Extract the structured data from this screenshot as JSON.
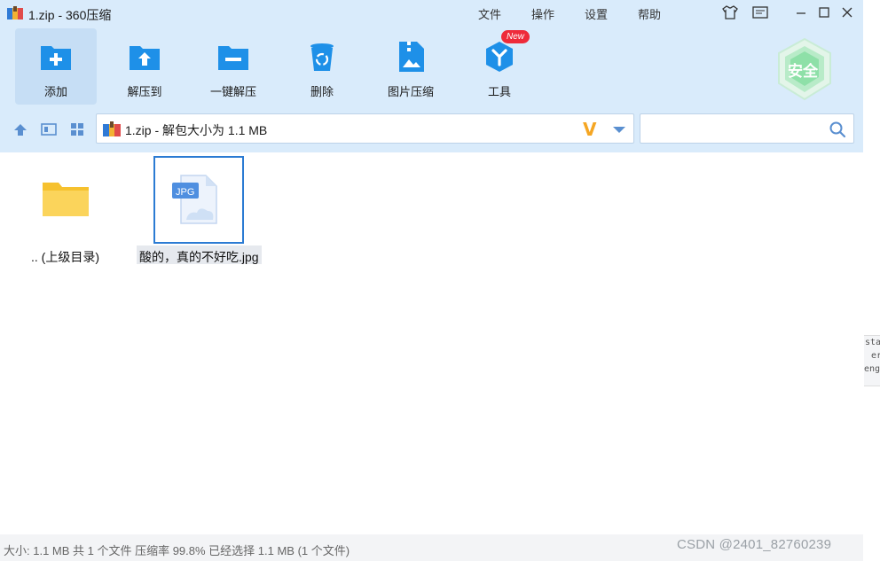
{
  "window": {
    "title": "1.zip - 360压缩",
    "menu": [
      "文件",
      "操作",
      "设置",
      "帮助"
    ]
  },
  "toolbar": {
    "tools": [
      {
        "label": "添加",
        "icon": "add-icon"
      },
      {
        "label": "解压到",
        "icon": "extract-to-icon"
      },
      {
        "label": "一键解压",
        "icon": "one-click-extract-icon"
      },
      {
        "label": "删除",
        "icon": "delete-icon"
      },
      {
        "label": "图片压缩",
        "icon": "image-compress-icon"
      },
      {
        "label": "工具",
        "icon": "tools-icon"
      }
    ],
    "new_badge": "New",
    "safe_badge": "安全"
  },
  "address": {
    "path": "1.zip - 解包大小为 1.1 MB",
    "search_placeholder": ""
  },
  "files": [
    {
      "name": ".. (上级目录)",
      "type": "folder"
    },
    {
      "name": "酸的，真的不好吃.jpg",
      "type": "jpg",
      "badge": "JPG",
      "selected": true
    }
  ],
  "status": {
    "text": "大小: 1.1 MB 共 1 个文件 压缩率 99.8% 已经选择 1.1 MB (1 个文件)"
  },
  "watermark": "CSDN @2401_82760239",
  "edge_snippet": [
    "sta",
    "er",
    "eng"
  ],
  "colors": {
    "chrome": "#d9ebfb",
    "accent": "#2b7bd3",
    "icon_blue": "#1e90e8",
    "new_badge": "#ee2b3a",
    "safe_green": "#3cc47a"
  }
}
